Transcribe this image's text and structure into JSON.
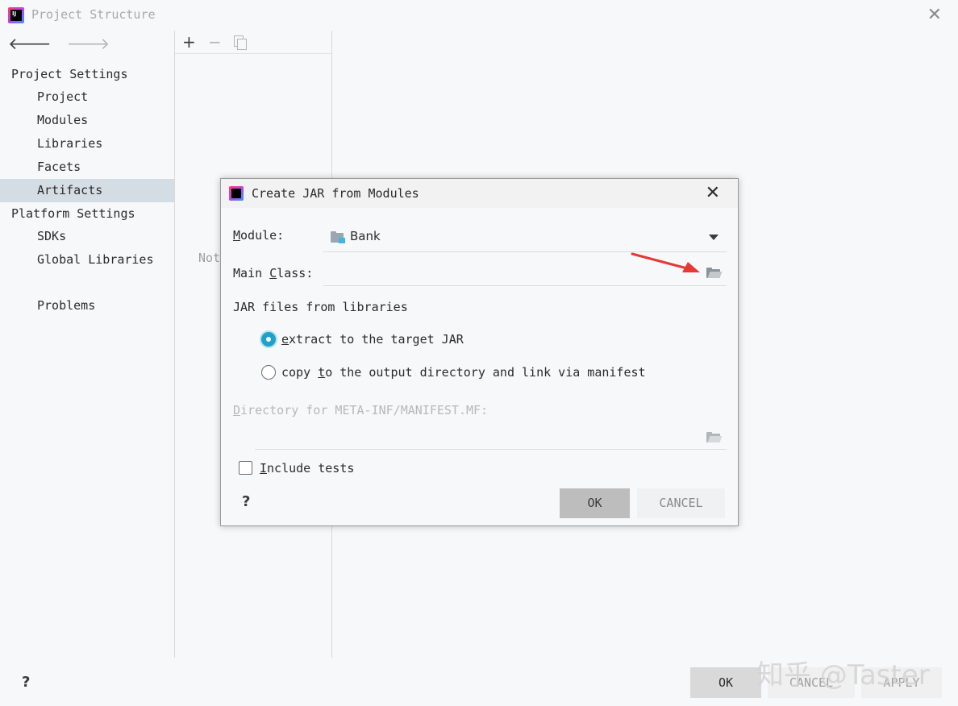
{
  "window": {
    "title": "Project Structure",
    "close_glyph": "✕",
    "back_glyph": "🡐",
    "forward_glyph": "🡒"
  },
  "sidebar": {
    "project_settings": "Project Settings",
    "project_items": [
      "Project",
      "Modules",
      "Libraries",
      "Facets",
      "Artifacts"
    ],
    "platform_settings": "Platform Settings",
    "platform_items": [
      "SDKs",
      "Global Libraries"
    ],
    "problems": "Problems",
    "selected": "Artifacts"
  },
  "toolbar": {
    "add": "+",
    "remove": "−"
  },
  "middle": {
    "partial_text": "Not"
  },
  "footer": {
    "help": "?",
    "ok": "OK",
    "cancel": "CANCEL",
    "apply": "APPLY",
    "watermark": "知乎 @Taster"
  },
  "dialog": {
    "title": "Create JAR from Modules",
    "close_glyph": "✕",
    "module_label_pre": "",
    "module_label_u": "M",
    "module_label_post": "odule:",
    "module_value": "Bank",
    "main_class_label_pre": "Main ",
    "main_class_label_u": "C",
    "main_class_label_post": "lass:",
    "main_class_value": "",
    "jar_files_label": "JAR files from libraries",
    "option_extract_u": "e",
    "option_extract_post": "xtract to the target JAR",
    "option_copy_pre": "copy ",
    "option_copy_u": "t",
    "option_copy_post": "o the output directory and link via manifest",
    "selected_option": "extract",
    "manifest_label_u": "D",
    "manifest_label_post": "irectory for META-INF/MANIFEST.MF:",
    "manifest_value": "",
    "include_tests_u": "I",
    "include_tests_post": "nclude tests",
    "include_tests_checked": false,
    "help": "?",
    "ok": "OK",
    "cancel": "CANCEL"
  },
  "colors": {
    "accent": "#1fa2c8",
    "selection": "#d5dde4",
    "annotation_arrow": "#e53935"
  }
}
